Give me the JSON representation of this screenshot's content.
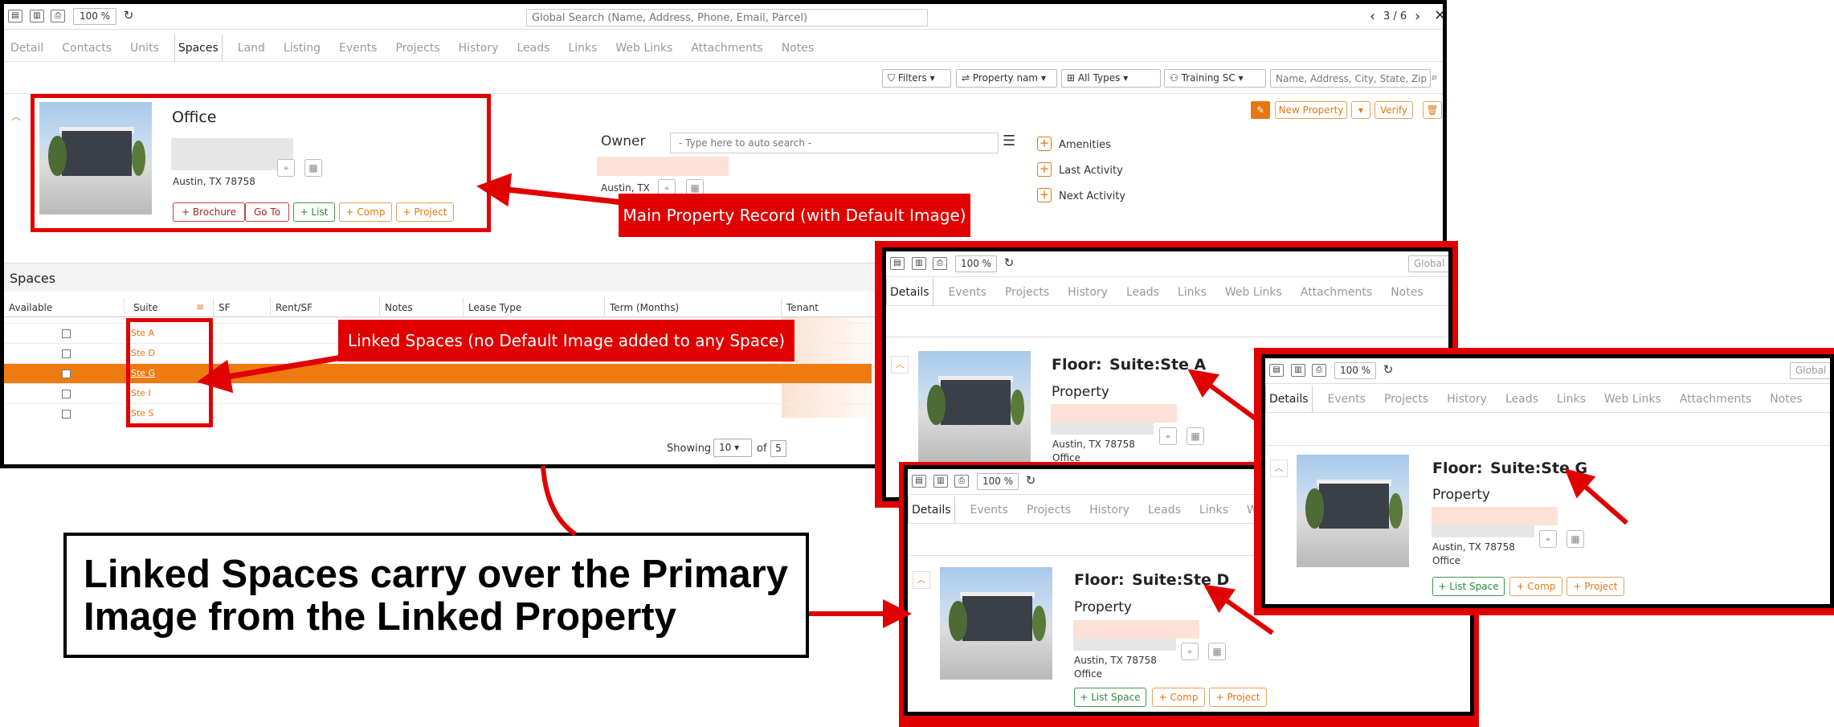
{
  "main": {
    "zoom": "100 %",
    "search_placeholder": "Global Search (Name, Address, Phone, Email, Parcel)",
    "pager": "3 / 6",
    "tabs": [
      "Detail",
      "Contacts",
      "Units",
      "Spaces",
      "Land",
      "Listing",
      "Events",
      "Projects",
      "History",
      "Leads",
      "Links",
      "Web Links",
      "Attachments",
      "Notes"
    ],
    "active_tab": "Spaces",
    "filters": {
      "filters_label": "Filters",
      "property_name": "Property nam",
      "types": "All Types",
      "training": "Training SC",
      "address_placeholder": "Name, Address, City, State, Zip"
    },
    "actions": {
      "new_property": "New Property",
      "verify": "Verify"
    },
    "property": {
      "title": "Office",
      "city_line": "Austin, TX 78758",
      "buttons": {
        "brochure": "+ Brochure",
        "goto": "Go To",
        "list": "+ List",
        "comp": "+ Comp",
        "project": "+ Project"
      }
    },
    "owner": {
      "label": "Owner",
      "placeholder": "- Type here to auto search -",
      "city": "Austin, TX"
    },
    "side": {
      "amenities": "Amenities",
      "last_activity": "Last Activity",
      "next_activity": "Next Activity"
    },
    "spaces": {
      "title": "Spaces",
      "headers": [
        "Available",
        "Suite",
        "SF",
        "Rent/SF",
        "Notes",
        "Lease Type",
        "Term (Months)",
        "Tenant"
      ],
      "suites": [
        "Ste A",
        "Ste D",
        "Ste G",
        "Ste I",
        "Ste S"
      ],
      "showing_label": "Showing",
      "page_size": "10",
      "of_label": "of",
      "total": "5"
    }
  },
  "callouts": {
    "main_record": "Main Property Record (with Default Image)",
    "linked_spaces": "Linked Spaces (no Default Image added to any Space)",
    "big_text_line1": "Linked Spaces carry over the Primary",
    "big_text_line2": "Image from the Linked Property"
  },
  "space_windows": {
    "zoom": "100 %",
    "tabs": [
      "Details",
      "Events",
      "Projects",
      "History",
      "Leads",
      "Links",
      "Web Links",
      "Attachments",
      "Notes"
    ],
    "search_stub": "Global",
    "floor_label": "Floor:",
    "property_label": "Property",
    "city_line": "Austin, TX 78758",
    "type": "Office",
    "buttons": {
      "list_space": "+ List Space",
      "comp": "+ Comp",
      "project": "+ Project"
    },
    "a": {
      "suite": "Suite:Ste A"
    },
    "d": {
      "suite": "Suite:Ste D"
    },
    "g": {
      "suite": "Suite:Ste G"
    }
  },
  "colors": {
    "accent": "#e67612",
    "callout_red": "#e00000",
    "selected_row": "#ef7a0f",
    "green": "#2a8a3a"
  }
}
